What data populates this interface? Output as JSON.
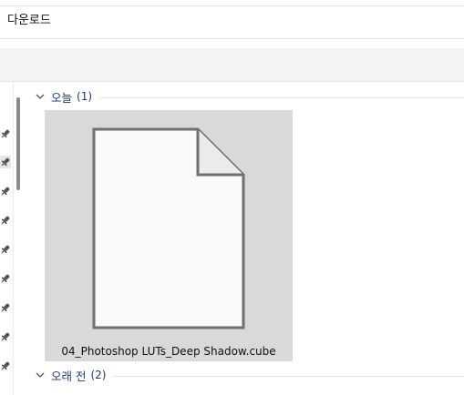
{
  "address_bar": {
    "path": "다운로드"
  },
  "nav": {
    "pins": [
      {
        "icon": "pin-icon",
        "selected": false
      },
      {
        "icon": "pin-icon",
        "selected": true
      },
      {
        "icon": "pin-icon",
        "selected": false
      },
      {
        "icon": "pin-icon",
        "selected": false
      },
      {
        "icon": "pin-icon",
        "selected": false
      },
      {
        "icon": "pin-icon",
        "selected": false
      },
      {
        "icon": "pin-icon",
        "selected": false
      },
      {
        "icon": "pin-icon",
        "selected": false
      },
      {
        "icon": "pin-icon",
        "selected": false
      }
    ]
  },
  "groups": [
    {
      "title": "오늘",
      "count": "(1)",
      "expanded_icon": "chevron-down-icon",
      "files": [
        {
          "name": "04_Photoshop LUTs_Deep Shadow.cube",
          "icon": "file-icon",
          "selected": true
        }
      ]
    },
    {
      "title": "오래 전",
      "count": "(2)",
      "expanded_icon": "chevron-down-icon"
    }
  ],
  "colors": {
    "group_header": "#1e3a78",
    "tile_selected": "#d9d9d9",
    "command_bar": "#f3f3f4"
  }
}
